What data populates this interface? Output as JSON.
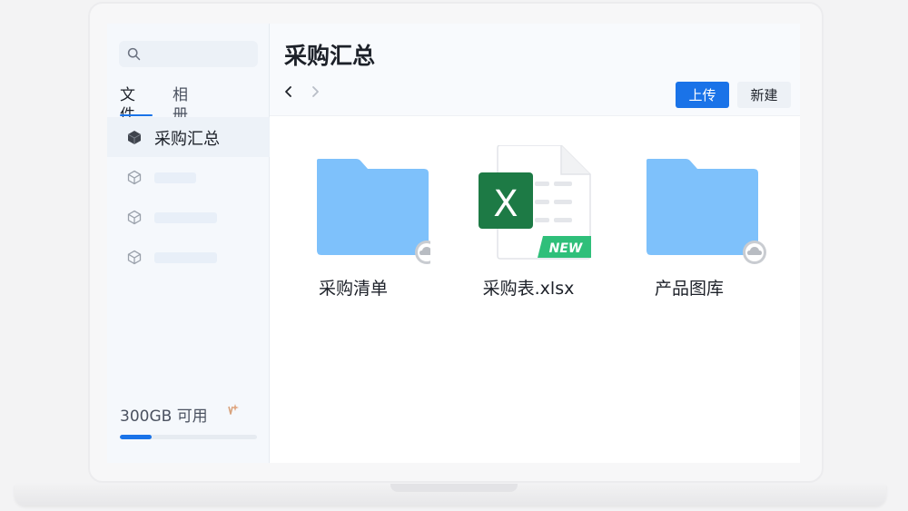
{
  "sidebar": {
    "search": {
      "placeholder": ""
    },
    "tabs": [
      {
        "label": "文件",
        "active": true
      },
      {
        "label": "相册",
        "active": false
      }
    ],
    "items": [
      {
        "label": "采购汇总",
        "active": true,
        "icon": "cube-icon"
      },
      {
        "label": "",
        "icon": "cube-outline-icon"
      },
      {
        "label": "",
        "icon": "cube-outline-icon"
      },
      {
        "label": "",
        "icon": "cube-outline-icon"
      }
    ],
    "storage": {
      "text": "300GB 可用",
      "used_fraction": 0.23
    }
  },
  "main": {
    "title": "采购汇总",
    "upload_label": "上传",
    "new_label": "新建",
    "files": [
      {
        "name": "采购清单",
        "type": "folder",
        "badge": "cloud-icon"
      },
      {
        "name": "采购表.xlsx",
        "type": "excel",
        "badge_text": "NEW",
        "icon_letter": "X"
      },
      {
        "name": "产品图库",
        "type": "folder",
        "badge": "cloud-icon"
      }
    ]
  },
  "colors": {
    "accent": "#1a73e8",
    "folder": "#7ec1fb",
    "excel": "#1d7a45",
    "new_badge": "#2fbf7a"
  }
}
